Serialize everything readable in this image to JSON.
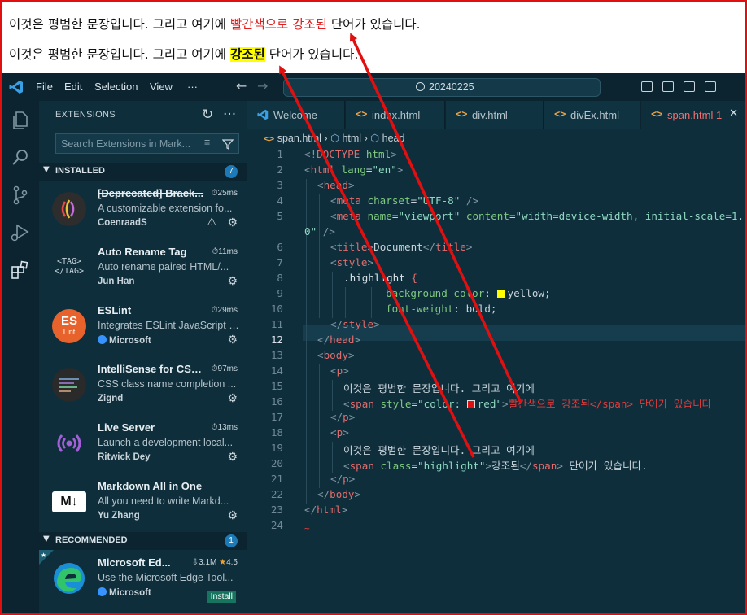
{
  "preview": {
    "line1_pre": "이것은 평범한 문장입니다. 그리고 여기에 ",
    "line1_red": "빨간색으로 강조된",
    "line1_post": " 단어가 있습니다.",
    "line2_pre": "이것은 평범한 문장입니다. 그리고 여기에 ",
    "line2_hl": "강조된",
    "line2_post": " 단어가 있습니다."
  },
  "titlebar": {
    "menus": [
      "File",
      "Edit",
      "Selection",
      "View",
      "···"
    ],
    "search": "20240225"
  },
  "sidebar": {
    "title": "EXTENSIONS",
    "search_placeholder": "Search Extensions in Mark...",
    "installed_label": "INSTALLED",
    "installed_count": "7",
    "recommended_label": "RECOMMENDED",
    "recommended_count": "1",
    "installed": [
      {
        "name": "[Deprecated] Brack...",
        "time": "25ms",
        "desc": "A customizable extension fo...",
        "publisher": "CoenraadS",
        "deprecated": true
      },
      {
        "name": "Auto Rename Tag",
        "time": "11ms",
        "desc": "Auto rename paired HTML/...",
        "publisher": "Jun Han"
      },
      {
        "name": "ESLint",
        "time": "29ms",
        "desc": "Integrates ESLint JavaScript i...",
        "publisher": "Microsoft",
        "verified": true
      },
      {
        "name": "IntelliSense for CSS...",
        "time": "97ms",
        "desc": "CSS class name completion ...",
        "publisher": "Zignd"
      },
      {
        "name": "Live Server",
        "time": "13ms",
        "desc": "Launch a development local...",
        "publisher": "Ritwick Dey"
      },
      {
        "name": "Markdown All in One",
        "time": "",
        "desc": "All you need to write Markd...",
        "publisher": "Yu Zhang"
      }
    ],
    "recommended": [
      {
        "name": "Microsoft Ed...",
        "downloads": "3.1M",
        "rating": "4.5",
        "desc": "Use the Microsoft Edge Tool...",
        "publisher": "Microsoft",
        "install": "Install"
      }
    ],
    "icon_text": {
      "tag": "<TAG>",
      "tag2": "</TAG>",
      "es": "ES",
      "lint": "Lint",
      "md": "M↓"
    }
  },
  "tabs": [
    {
      "label": "Welcome",
      "icon": "vscode-icon"
    },
    {
      "label": "index.html",
      "icon": "html-icon"
    },
    {
      "label": "div.html",
      "icon": "html-icon"
    },
    {
      "label": "divEx.html",
      "icon": "html-icon"
    },
    {
      "label": "span.html 1",
      "icon": "html-icon",
      "active": true
    }
  ],
  "breadcrumb": [
    "span.html",
    "html",
    "head"
  ],
  "code": {
    "line_numbers": [
      "1",
      "2",
      "3",
      "4",
      "5",
      "",
      "6",
      "7",
      "8",
      "9",
      "10",
      "11",
      "12",
      "13",
      "14",
      "15",
      "16",
      "17",
      "18",
      "19",
      "20",
      "21",
      "22",
      "23",
      "24"
    ],
    "text": {
      "l1_a": "<!",
      "l1_b": "DOCTYPE",
      "l1_c": " html",
      "l1_d": ">",
      "l2_a": "<",
      "l2_b": "html",
      "l2_c": " lang",
      "l2_d": "=",
      "l2_e": "\"en\"",
      "l2_f": ">",
      "l3_a": "<",
      "l3_b": "head",
      "l3_c": ">",
      "l4_a": "<",
      "l4_b": "meta",
      "l4_c": " charset",
      "l4_d": "=",
      "l4_e": "\"UTF-8\"",
      "l4_f": " />",
      "l5_a": "<",
      "l5_b": "meta",
      "l5_c": " name",
      "l5_d": "=",
      "l5_e": "\"viewport\"",
      "l5_f": " content",
      "l5_g": "=",
      "l5_h": "\"width=device-width, initial-scale=1.",
      "l5w_a": "0\"",
      "l5w_b": " />",
      "l6_a": "<",
      "l6_b": "title",
      "l6_c": ">",
      "l6_d": "Document",
      "l6_e": "</",
      "l6_f": "title",
      "l6_g": ">",
      "l7_a": "<",
      "l7_b": "style",
      "l7_c": ">",
      "l8_a": ".highlight",
      "l8_b": " {",
      "l9_a": "background-color",
      "l9_b": ": ",
      "l9_c": "yellow",
      "l9_d": ";",
      "l10_a": "font-weight",
      "l10_b": ": ",
      "l10_c": "bold",
      "l10_d": ";",
      "l11_a": "</",
      "l11_b": "style",
      "l11_c": ">",
      "l12_a": "</",
      "l12_b": "head",
      "l12_c": ">",
      "l13_a": "<",
      "l13_b": "body",
      "l13_c": ">",
      "l14_a": "<",
      "l14_b": "p",
      "l14_c": ">",
      "l15_a": "이것은 평범한 문장입니다. 그리고 여기에",
      "l16_a": "<",
      "l16_b": "span",
      "l16_c": " style",
      "l16_d": "=",
      "l16_e": "\"color: ",
      "l16_f": "red\"",
      "l16_g": ">",
      "l16_h": "빨간색으로 강조된</span> 단어가 있습니다",
      "l17_a": "</",
      "l17_b": "p",
      "l17_c": ">",
      "l18_a": "<",
      "l18_b": "p",
      "l18_c": ">",
      "l19_a": "이것은 평범한 문장입니다. 그리고 여기에",
      "l20_a": "<",
      "l20_b": "span",
      "l20_c": " class",
      "l20_d": "=",
      "l20_e": "\"highlight\"",
      "l20_f": ">",
      "l20_g": "강조된",
      "l20_h": "</",
      "l20_i": "span",
      "l20_j": ">",
      "l20_k": " 단어가 있습니다.",
      "l21_a": "</",
      "l21_b": "p",
      "l21_c": ">",
      "l22_a": "</",
      "l22_b": "body",
      "l22_c": ">",
      "l23_a": "</",
      "l23_b": "html",
      "l23_c": ">"
    }
  },
  "colors": {
    "accent_red": "#e02020",
    "highlight": "#ffff00",
    "bg": "#0f2e3c"
  }
}
